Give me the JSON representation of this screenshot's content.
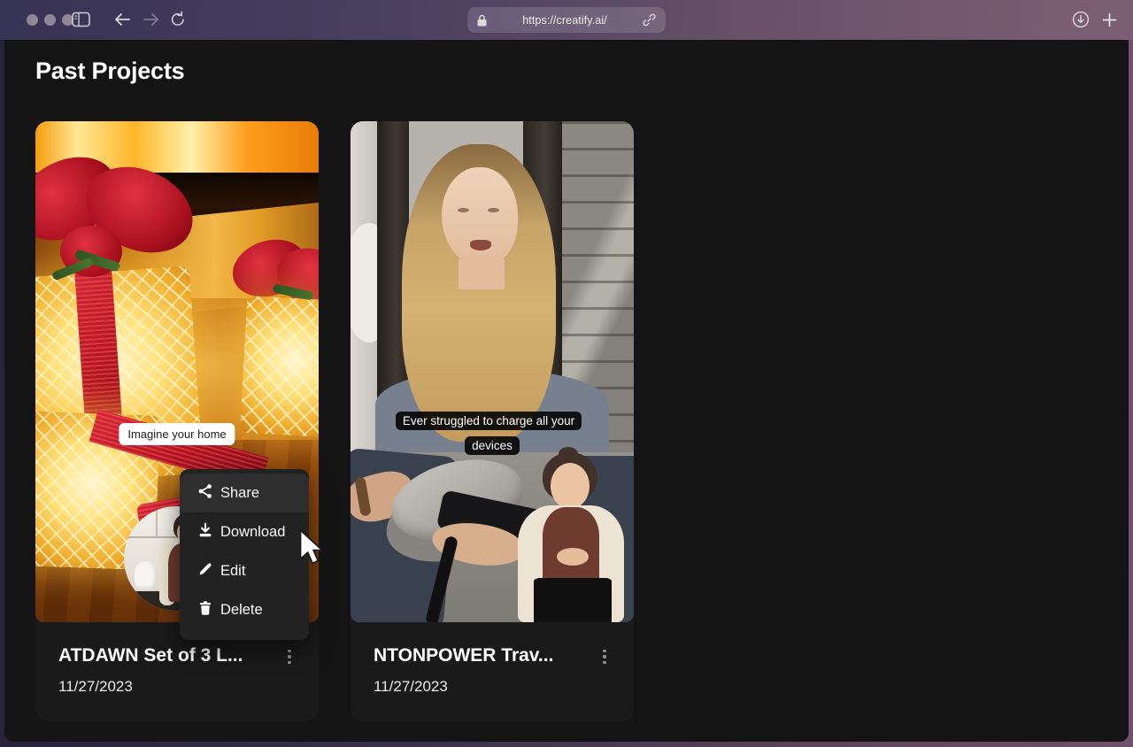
{
  "browser": {
    "url": "https://creatify.ai/",
    "toolbar_icons": [
      "sidebar-toggle-icon",
      "back-icon",
      "forward-icon",
      "reload-icon",
      "lock-icon",
      "link-icon",
      "downloads-icon",
      "new-tab-icon"
    ]
  },
  "page": {
    "heading": "Past Projects",
    "cards": [
      {
        "title": "ATDAWN Set of 3 L...",
        "date": "11/27/2023",
        "caption": "Imagine your home"
      },
      {
        "title": "NTONPOWER Trav...",
        "date": "11/27/2023",
        "caption": "Ever struggled to charge all your devices"
      }
    ],
    "context_menu": {
      "items": [
        {
          "label": "Share",
          "icon": "share-icon"
        },
        {
          "label": "Download",
          "icon": "download-icon"
        },
        {
          "label": "Edit",
          "icon": "edit-icon"
        },
        {
          "label": "Delete",
          "icon": "delete-icon"
        }
      ]
    }
  },
  "colors": {
    "desktop_gradient_start": "#262239",
    "desktop_gradient_end": "#6f516a",
    "chrome_gradient_start": "#373353",
    "chrome_gradient_end": "#7d5f75",
    "page_bg": "#141414",
    "card_bg": "#1a1a1a",
    "menu_bg": "#222222",
    "menu_highlight": "#2e2e2e",
    "caption_light_bg": "#ffffff",
    "caption_dark_bg": "#000000",
    "text_primary": "#ffffff"
  }
}
